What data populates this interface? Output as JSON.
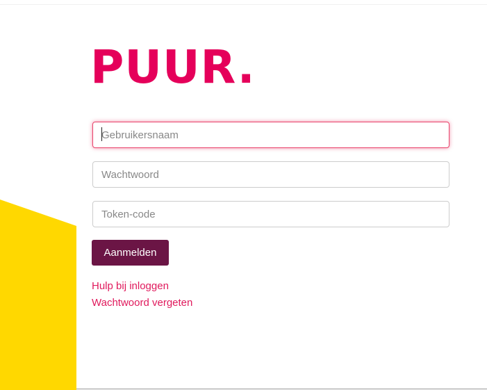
{
  "brand": {
    "logo_text": "PUUR.",
    "primary_color": "#e5005a",
    "button_color": "#6b1545",
    "accent_yellow": "#ffd800"
  },
  "login_form": {
    "username_placeholder": "Gebruikersnaam",
    "username_value": "",
    "password_placeholder": "Wachtwoord",
    "password_value": "",
    "token_placeholder": "Token-code",
    "token_value": "",
    "submit_label": "Aanmelden"
  },
  "links": {
    "help_label": "Hulp bij inloggen",
    "forgot_password_label": "Wachtwoord vergeten"
  }
}
